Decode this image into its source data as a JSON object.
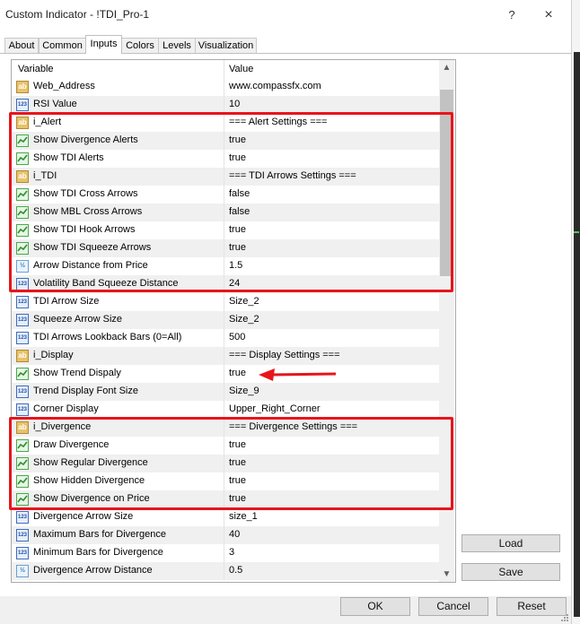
{
  "window": {
    "title": "Custom Indicator - !TDI_Pro-1",
    "help_label": "?",
    "close_label": "×"
  },
  "tabs": [
    {
      "label": "About",
      "active": false
    },
    {
      "label": "Common",
      "active": false
    },
    {
      "label": "Inputs",
      "active": true
    },
    {
      "label": "Colors",
      "active": false
    },
    {
      "label": "Levels",
      "active": false
    },
    {
      "label": "Visualization",
      "active": false
    }
  ],
  "table": {
    "header_variable": "Variable",
    "header_value": "Value",
    "rows": [
      {
        "icon": "ab",
        "name": "Web_Address",
        "value": "www.compassfx.com"
      },
      {
        "icon": "123",
        "name": "RSI Value",
        "value": "10"
      },
      {
        "icon": "ab",
        "name": "i_Alert",
        "value": "=== Alert Settings ==="
      },
      {
        "icon": "bool",
        "name": "Show Divergence Alerts",
        "value": "true"
      },
      {
        "icon": "bool",
        "name": "Show TDI Alerts",
        "value": "true"
      },
      {
        "icon": "ab",
        "name": "i_TDI",
        "value": "=== TDI Arrows Settings ==="
      },
      {
        "icon": "bool",
        "name": "Show TDI Cross Arrows",
        "value": "false"
      },
      {
        "icon": "bool",
        "name": "Show MBL Cross Arrows",
        "value": "false"
      },
      {
        "icon": "bool",
        "name": "Show TDI Hook Arrows",
        "value": "true"
      },
      {
        "icon": "bool",
        "name": "Show TDI Squeeze Arrows",
        "value": "true"
      },
      {
        "icon": "half",
        "name": "Arrow Distance from Price",
        "value": "1.5"
      },
      {
        "icon": "123",
        "name": "Volatility Band Squeeze Distance",
        "value": "24"
      },
      {
        "icon": "123",
        "name": "TDI Arrow Size",
        "value": "Size_2"
      },
      {
        "icon": "123",
        "name": "Squeeze Arrow Size",
        "value": "Size_2"
      },
      {
        "icon": "123",
        "name": "TDI Arrows Lookback Bars  (0=All)",
        "value": "500"
      },
      {
        "icon": "ab",
        "name": "i_Display",
        "value": "=== Display Settings ==="
      },
      {
        "icon": "bool",
        "name": "Show Trend Dispaly",
        "value": "true"
      },
      {
        "icon": "123",
        "name": "Trend Display Font Size",
        "value": "Size_9"
      },
      {
        "icon": "123",
        "name": "Corner Display",
        "value": "Upper_Right_Corner"
      },
      {
        "icon": "ab",
        "name": "i_Divergence",
        "value": "=== Divergence Settings ==="
      },
      {
        "icon": "bool",
        "name": "Draw Divergence",
        "value": "true"
      },
      {
        "icon": "bool",
        "name": "Show Regular Divergence",
        "value": "true"
      },
      {
        "icon": "bool",
        "name": "Show Hidden Divergence",
        "value": "true"
      },
      {
        "icon": "bool",
        "name": "Show Divergence on Price",
        "value": "true"
      },
      {
        "icon": "123",
        "name": "Divergence Arrow Size",
        "value": "size_1"
      },
      {
        "icon": "123",
        "name": "Maximum Bars for Divergence",
        "value": "40"
      },
      {
        "icon": "123",
        "name": "Minimum Bars for Divergence",
        "value": "3"
      },
      {
        "icon": "half",
        "name": "Divergence Arrow Distance",
        "value": "0.5"
      }
    ]
  },
  "icon_glyphs": {
    "ab": "ab",
    "123": "123",
    "half": "½"
  },
  "side_buttons": {
    "load": "Load",
    "save": "Save"
  },
  "footer_buttons": {
    "ok": "OK",
    "cancel": "Cancel",
    "reset": "Reset"
  },
  "colors": {
    "highlight": "#e8141b",
    "row_alt": "#f0f0f0"
  }
}
